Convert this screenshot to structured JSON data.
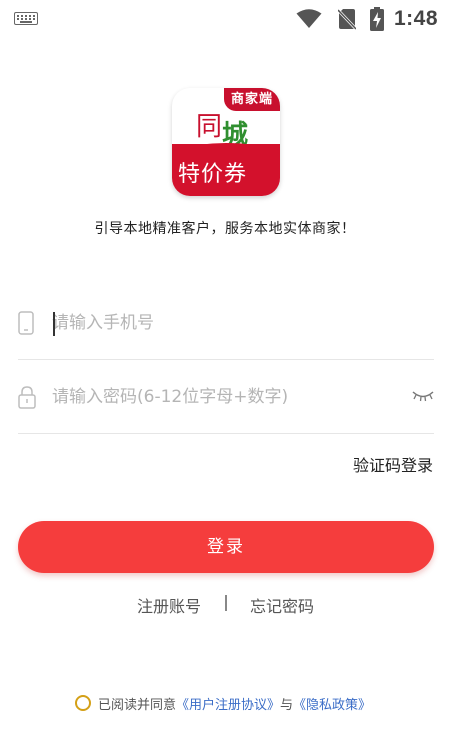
{
  "status_bar": {
    "time": "1:48",
    "icons": [
      "keyboard-icon",
      "wifi-icon",
      "no-sim-icon",
      "battery-charging-icon"
    ]
  },
  "logo": {
    "badge": "商家端",
    "line1_char1": "同",
    "line1_char2": "城",
    "line2": "特价券"
  },
  "slogan": "引导本地精准客户，服务本地实体商家！",
  "form": {
    "phone_placeholder": "请输入手机号",
    "password_placeholder": "请输入密码(6-12位字母+数字)",
    "phone_value": "",
    "password_value": ""
  },
  "code_login_label": "验证码登录",
  "login_button_label": "登录",
  "links": {
    "register": "注册账号",
    "forgot": "忘记密码"
  },
  "agreement": {
    "prefix": "已阅读并同意",
    "user_agreement": "《用户注册协议》",
    "conjunction": "与",
    "privacy": "《隐私政策》"
  },
  "colors": {
    "primary_button": "#f53d3d",
    "brand_red": "#c8102e",
    "brand_green": "#2f8f2f",
    "link_blue": "#3b6dc7",
    "radio_gold": "#d4a017"
  }
}
